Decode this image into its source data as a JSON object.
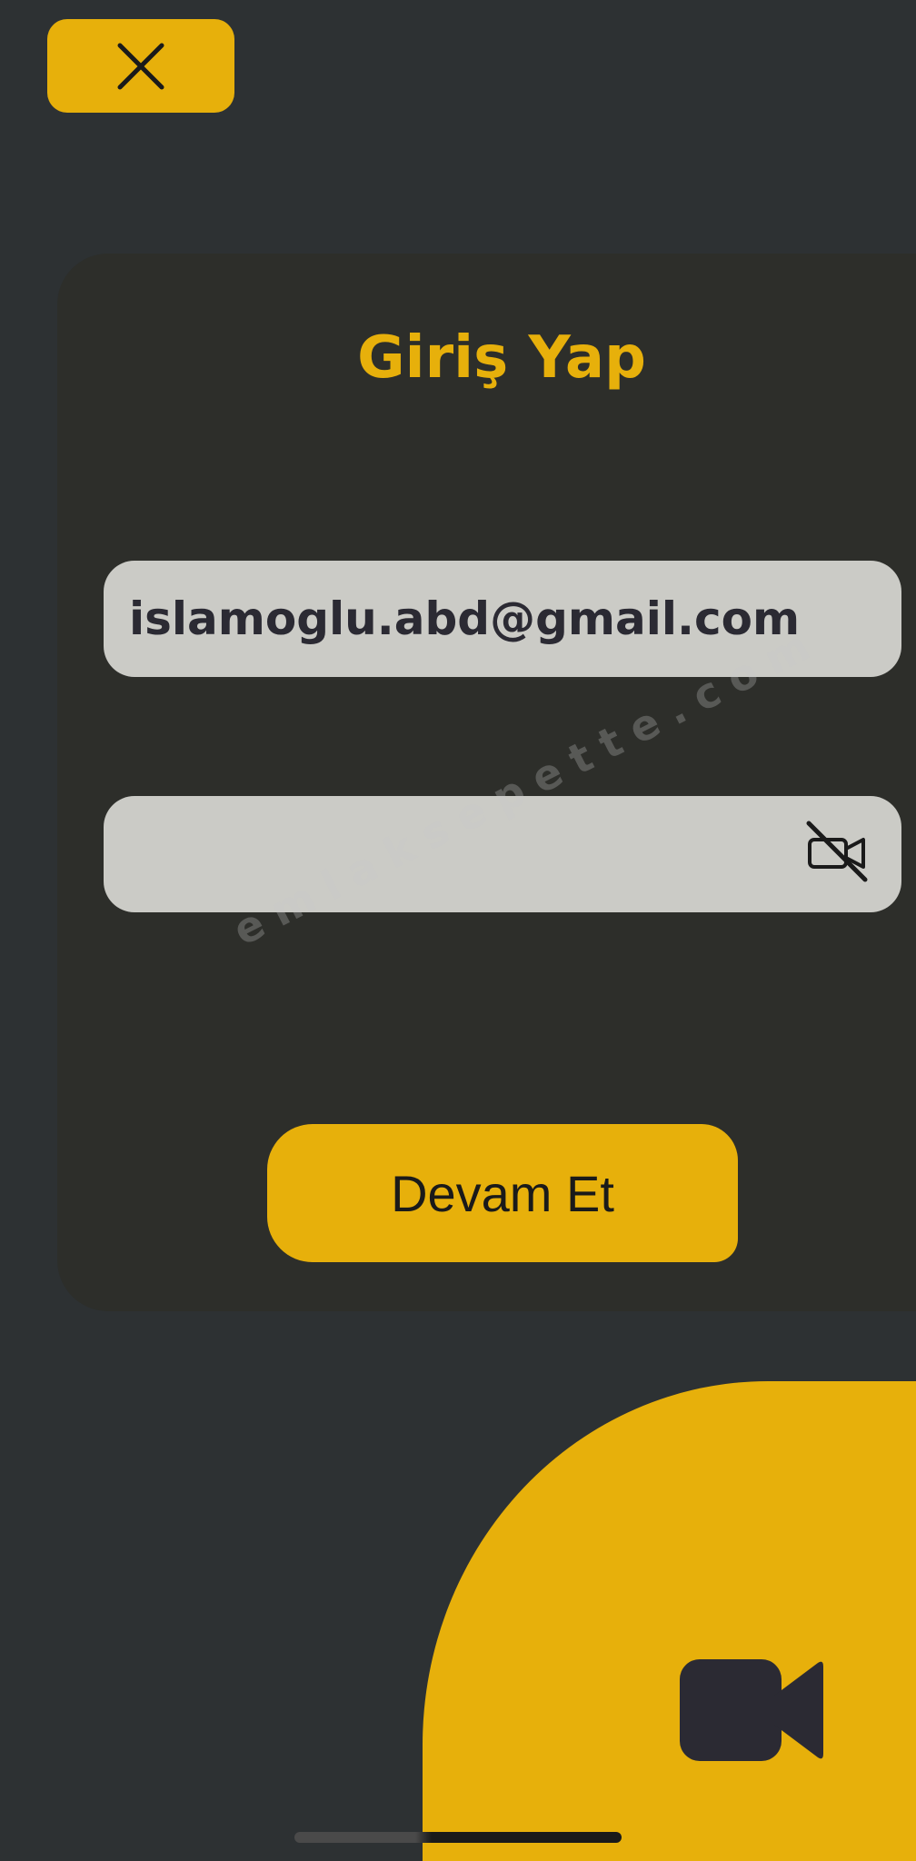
{
  "header": {
    "close_icon": "close-icon"
  },
  "login": {
    "title": "Giriş Yap",
    "email_value": "islamoglu.abd@gmail.com",
    "password_value": "",
    "password_toggle_icon": "video-off-icon",
    "continue_label": "Devam Et"
  },
  "watermark": {
    "text": "emlaksepette.com"
  },
  "floating": {
    "camera_icon": "video-camera-icon"
  },
  "colors": {
    "accent": "#e7b00b",
    "background": "#2d3133",
    "card": "#2d2e2a",
    "field": "#cbcbc6",
    "text_dark": "#2b2a33"
  }
}
